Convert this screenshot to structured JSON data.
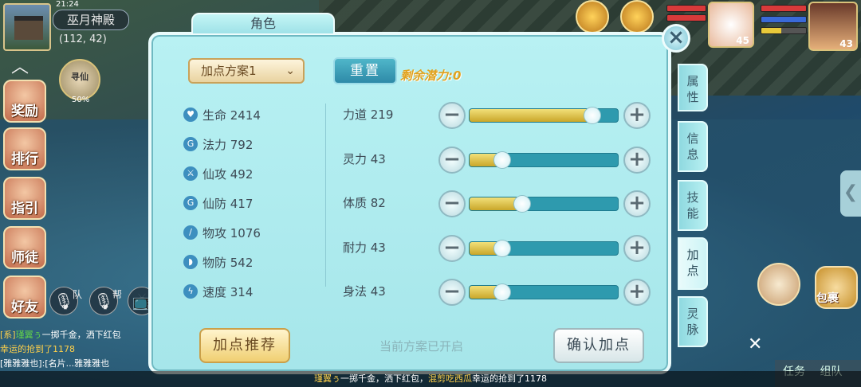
{
  "status": {
    "time": "21:24"
  },
  "location": {
    "name": "巫月神殿",
    "coords": "(112, 42)"
  },
  "fairy": {
    "name": "寻仙",
    "percent": "50%"
  },
  "left_menu": [
    {
      "label": "奖励",
      "icon": "gift-icon"
    },
    {
      "label": "排行",
      "icon": "banner-icon"
    },
    {
      "label": "指引",
      "icon": "scroll-icon"
    },
    {
      "label": "师徒",
      "icon": "brush-icon"
    },
    {
      "label": "好友",
      "icon": "cat-icon"
    }
  ],
  "voice": {
    "team_label": "队",
    "guild_label": "帮"
  },
  "chat": {
    "line1_tag": "[系]",
    "line1_name": "瑾翼ぅ",
    "line1_text": "一掷千金，洒下红包",
    "line2_text": "幸运的抢到了1178",
    "line3": "[雅雅雅也]:[名片...雅雅雅也"
  },
  "ticker": {
    "name": "瑾翼ぅ",
    "text1": "一掷千金，洒下红包，",
    "name2": "混剪吃西瓜",
    "text2": "幸运的抢到了1178"
  },
  "top_right": {
    "pet_level": "45",
    "hero_level": "43"
  },
  "panel": {
    "title": "角色",
    "plan_label": "加点方案1",
    "reset_label": "重置",
    "remain_label": "剩余潜力:0",
    "attributes": [
      {
        "label": "生命 2414",
        "icon": "heart-icon"
      },
      {
        "label": "法力 792",
        "icon": "swirl-icon"
      },
      {
        "label": "仙攻 492",
        "icon": "sword-icon"
      },
      {
        "label": "仙防 417",
        "icon": "shield-swirl-icon"
      },
      {
        "label": "物攻 1076",
        "icon": "blade-icon"
      },
      {
        "label": "物防 542",
        "icon": "shield-icon"
      },
      {
        "label": "速度 314",
        "icon": "lightning-icon"
      }
    ],
    "points": [
      {
        "label": "力道 219",
        "fraction": 0.82
      },
      {
        "label": "灵力 43",
        "fraction": 0.22
      },
      {
        "label": "体质 82",
        "fraction": 0.35
      },
      {
        "label": "耐力 43",
        "fraction": 0.22
      },
      {
        "label": "身法 43",
        "fraction": 0.22
      }
    ],
    "recommend_label": "加点推荐",
    "status_text": "当前方案已开启",
    "confirm_label": "确认加点",
    "tabs": [
      "属性",
      "信息",
      "技能",
      "加点",
      "灵脉"
    ],
    "active_tab": 3
  },
  "bottom_right": {
    "bag_label": "包裹",
    "task_label": "任务",
    "team_label": "组队"
  }
}
